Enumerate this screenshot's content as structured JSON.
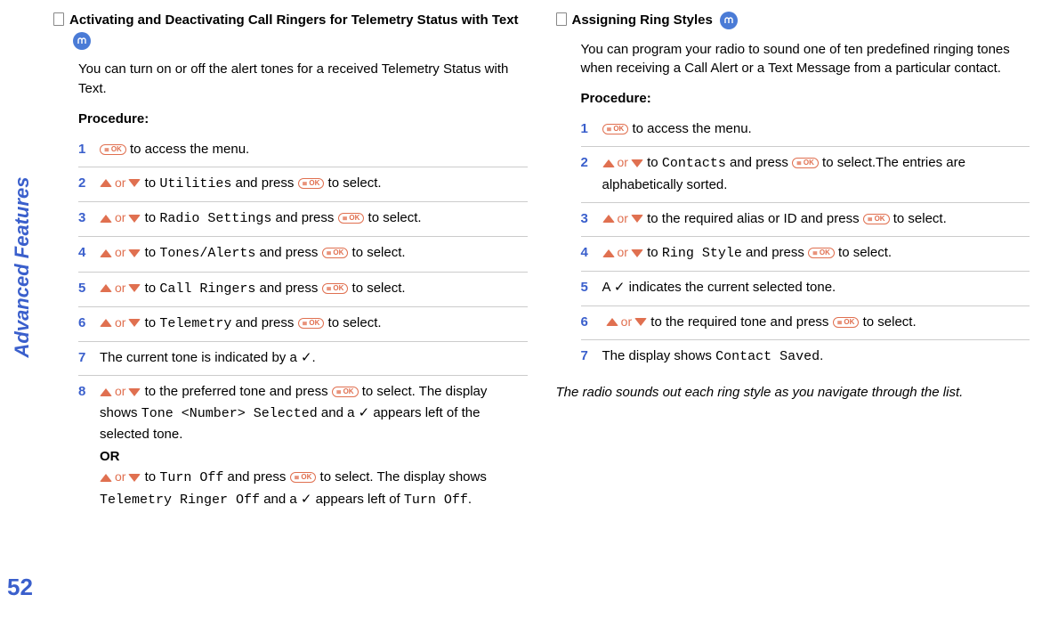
{
  "sideLabel": "Advanced Features",
  "pageNumber": "52",
  "left": {
    "title": "Activating and Deactivating Call Ringers for Telemetry Status with Text",
    "intro": "You can turn on or off the alert tones for a received Telemetry Status with Text.",
    "procLabel": "Procedure:",
    "steps": {
      "s1": {
        "num": "1",
        "tail": " to access the menu."
      },
      "s2": {
        "num": "2",
        "to": " to ",
        "menu": "Utilities",
        "and": " and press ",
        "tail": " to select."
      },
      "s3": {
        "num": "3",
        "to": " to ",
        "menu": "Radio Settings",
        "and": " and press ",
        "tail": " to select."
      },
      "s4": {
        "num": "4",
        "to": " to ",
        "menu": "Tones/Alerts",
        "and": " and press ",
        "tail": " to select."
      },
      "s5": {
        "num": "5",
        "to": " to ",
        "menu": "Call Ringers",
        "and": " and press ",
        "tail": " to select."
      },
      "s6": {
        "num": "6",
        "to": " to ",
        "menu": "Telemetry",
        "and": " and press ",
        "tail": " to select."
      },
      "s7": {
        "num": "7",
        "text": "The current tone is indicated by a ✓."
      },
      "s8": {
        "num": "8",
        "toA": " to the preferred tone and press ",
        "tailA1": " to select. The display shows ",
        "monoA": "Tone <Number> Selected",
        "tailA2": " and a ✓ appears left of the selected tone.",
        "orLabel": "OR",
        "toB": " to ",
        "monoB1": "Turn Off",
        "andB": " and press ",
        "tailB1": " to select. The display shows ",
        "monoB2": "Telemetry Ringer Off",
        "tailB2": " and a ✓ appears left of ",
        "monoB3": "Turn Off",
        "period": "."
      }
    }
  },
  "right": {
    "title": "Assigning Ring Styles",
    "intro": "You can program your radio to sound one of ten predefined ringing tones when receiving a Call Alert or a Text Message from a particular contact.",
    "procLabel": "Procedure:",
    "steps": {
      "s1": {
        "num": "1",
        "tail": " to access the menu."
      },
      "s2": {
        "num": "2",
        "to": " to ",
        "menu": "Contacts",
        "and": " and press ",
        "tail": " to select.The entries are alphabetically sorted."
      },
      "s3": {
        "num": "3",
        "to": " to the required alias or ID and press ",
        "tail": " to select."
      },
      "s4": {
        "num": "4",
        "to": " to ",
        "menu": "Ring Style",
        "and": " and press ",
        "tail": " to select."
      },
      "s5": {
        "num": "5",
        "text": "A ✓ indicates the current selected tone."
      },
      "s6": {
        "num": "6",
        "to": " to the required tone and press ",
        "tail": " to select."
      },
      "s7": {
        "num": "7",
        "pre": "The display shows ",
        "mono": "Contact Saved",
        "post": "."
      }
    },
    "footnote": "The radio sounds out each ring style as you navigate through the list."
  },
  "okLabel": "OK",
  "orLabel": "or"
}
